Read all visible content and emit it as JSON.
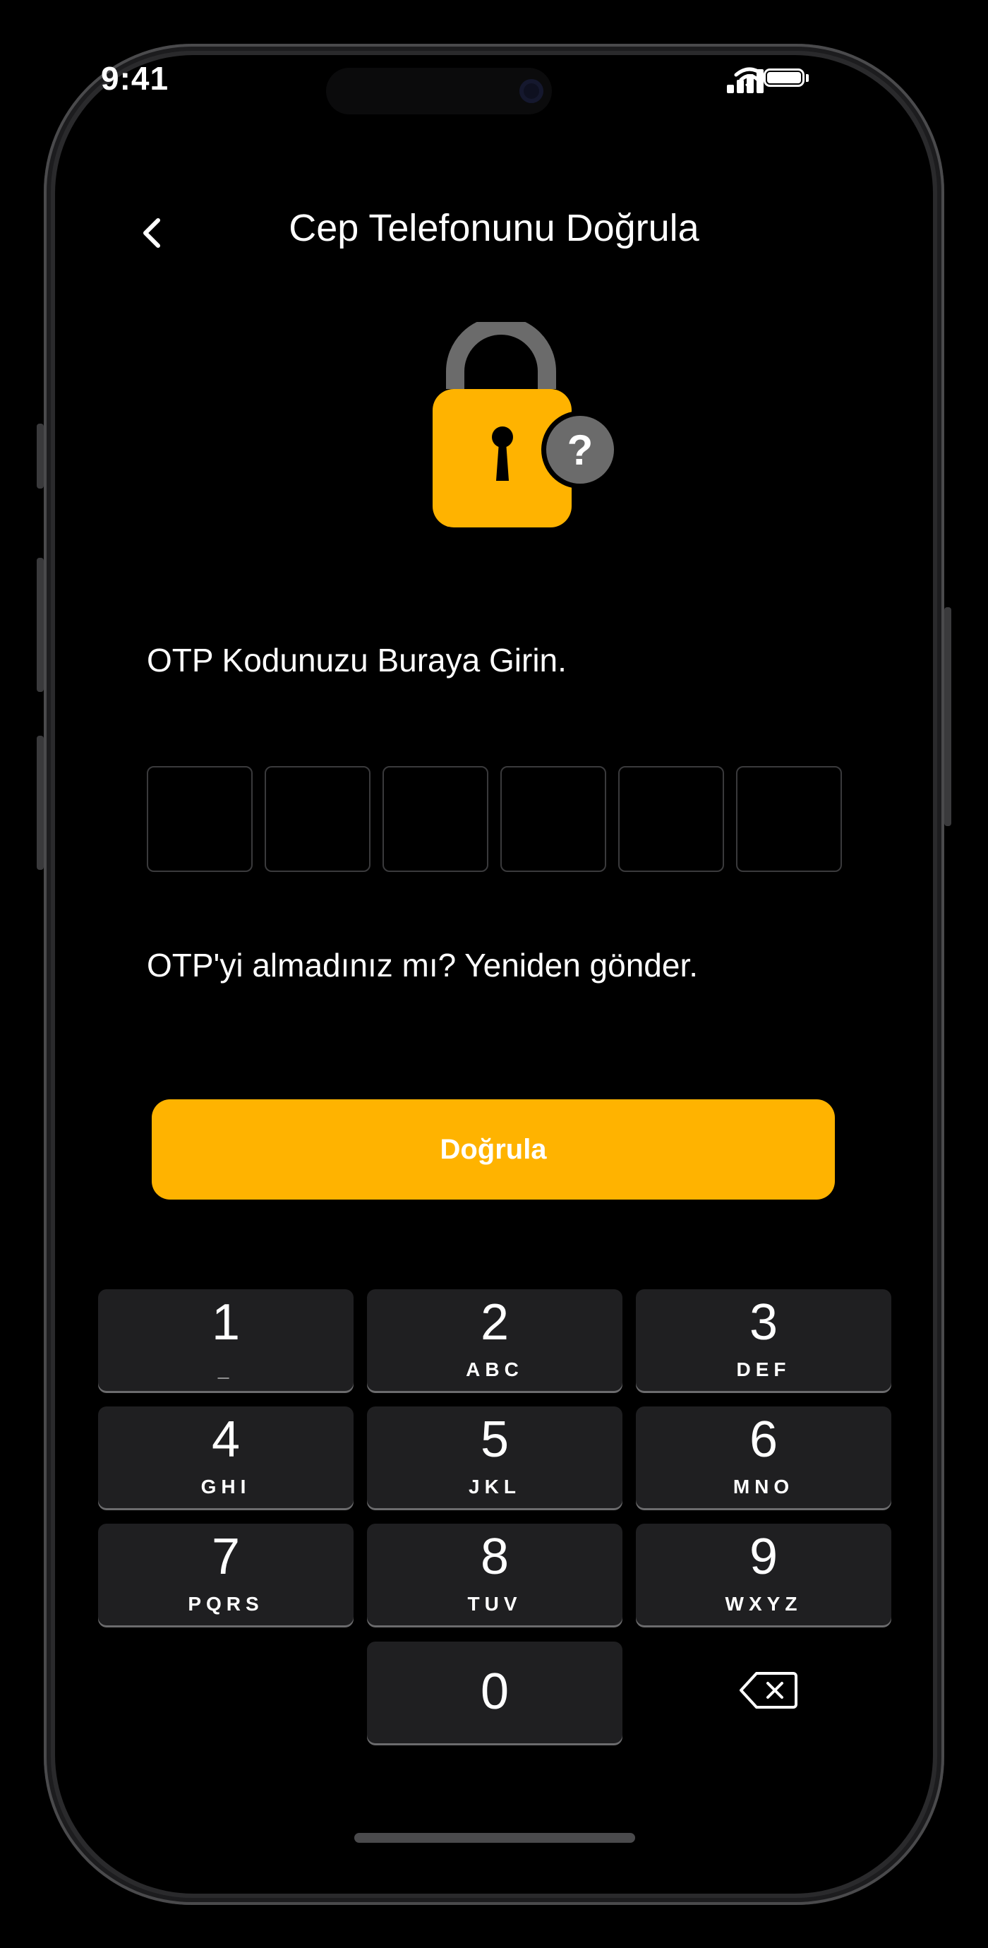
{
  "status_bar": {
    "time": "9:41",
    "signal_icon": "cellular-signal-icon",
    "wifi_icon": "wifi-icon",
    "battery_icon": "battery-full-icon"
  },
  "header": {
    "title": "Cep Telefonunu Doğrula",
    "back_icon": "chevron-left-icon"
  },
  "illustration": {
    "icon": "padlock-question-icon",
    "badge_text": "?",
    "colors": {
      "lock_body": "#FFB300",
      "shackle": "#6b6b6b",
      "badge": "#6b6b6b"
    }
  },
  "otp": {
    "instruction": "OTP Kodunuzu Buraya Girin.",
    "digit_count": 6,
    "resend_text": "OTP'yi almadınız mı? Yeniden gönder."
  },
  "verify_button": {
    "label": "Doğrula",
    "color": "#FFB300"
  },
  "keypad": {
    "keys": [
      {
        "digit": "1",
        "letters": "_"
      },
      {
        "digit": "2",
        "letters": "ABC"
      },
      {
        "digit": "3",
        "letters": "DEF"
      },
      {
        "digit": "4",
        "letters": "GHI"
      },
      {
        "digit": "5",
        "letters": "JKL"
      },
      {
        "digit": "6",
        "letters": "MNO"
      },
      {
        "digit": "7",
        "letters": "PQRS"
      },
      {
        "digit": "8",
        "letters": "TUV"
      },
      {
        "digit": "9",
        "letters": "WXYZ"
      },
      {
        "digit": "0",
        "letters": ""
      }
    ],
    "delete_icon": "backspace-icon"
  }
}
